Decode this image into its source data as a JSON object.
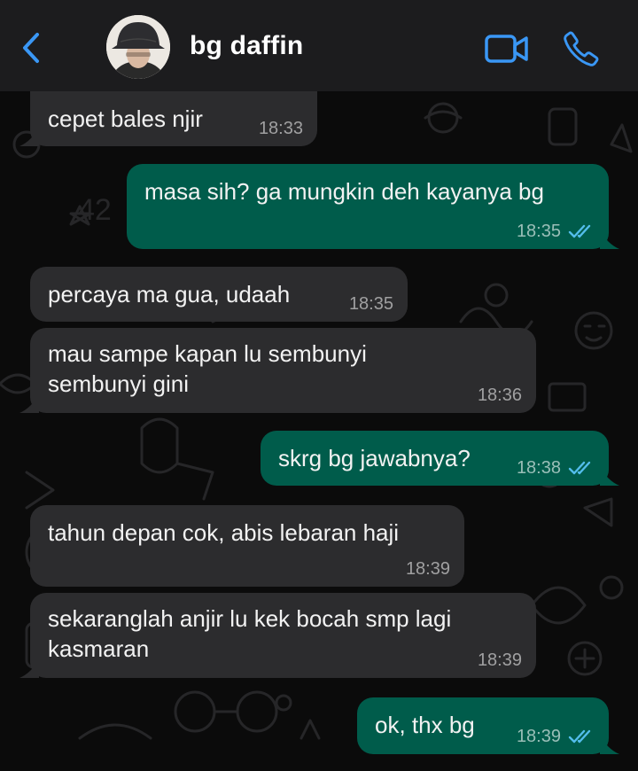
{
  "header": {
    "contact_name": "bg daffin"
  },
  "icons": {
    "back": "chevron-left-icon",
    "video": "video-camera-icon",
    "call": "phone-icon",
    "ticks": "double-check-icon"
  },
  "colors": {
    "header_bg": "#1c1c1e",
    "chat_bg": "#0b0b0b",
    "incoming_bubble": "#2c2c2e",
    "outgoing_bubble": "#005c4b",
    "accent": "#3a97f5",
    "read_ticks": "#53bdeb"
  },
  "messages": [
    {
      "direction": "in",
      "text": "cepet bales njir",
      "time": "18:33"
    },
    {
      "direction": "out",
      "text": "masa sih? ga mungkin deh kayanya bg",
      "time": "18:35",
      "status": "read"
    },
    {
      "direction": "in",
      "text": "percaya ma gua, udaah",
      "time": "18:35"
    },
    {
      "direction": "in",
      "text": "mau sampe kapan lu sembunyi\nsembunyi gini",
      "time": "18:36"
    },
    {
      "direction": "out",
      "text": "skrg bg jawabnya?",
      "time": "18:38",
      "status": "read"
    },
    {
      "direction": "in",
      "text": "tahun depan cok, abis lebaran haji",
      "time": "18:39"
    },
    {
      "direction": "in",
      "text": "sekaranglah anjir lu kek bocah smp lagi\nkasmaran",
      "time": "18:39"
    },
    {
      "direction": "out",
      "text": "ok, thx bg",
      "time": "18:39",
      "status": "read"
    }
  ]
}
